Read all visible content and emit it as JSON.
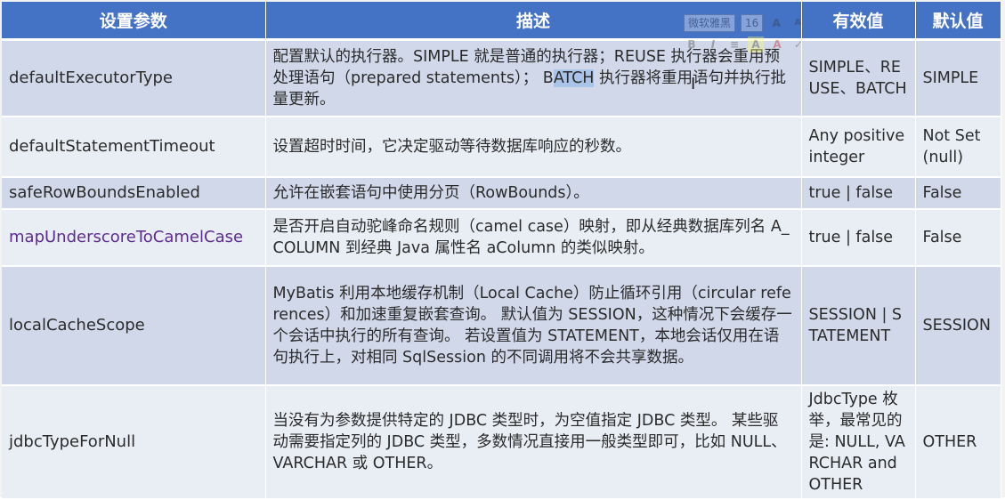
{
  "table": {
    "headers": [
      "设置参数",
      "描述",
      "有效值",
      "默认值"
    ],
    "rows": [
      {
        "param": "defaultExecutorType",
        "desc_before": "配置默认的执行器。SIMPLE 就是普通的执行器；REUSE 执行器会重用预处理语句（prepared statements）； B",
        "desc_selected": "ATCH",
        "desc_after": " 执行器将重用语句并执行批量更新。",
        "valid": "SIMPLE、REUSE、BATCH",
        "default": "SIMPLE"
      },
      {
        "param": "defaultStatementTimeout",
        "desc": "设置超时时间，它决定驱动等待数据库响应的秒数。",
        "valid": "Any positive integer",
        "default": "Not Set (null)"
      },
      {
        "param": "safeRowBoundsEnabled",
        "desc": "允许在嵌套语句中使用分页（RowBounds）。",
        "valid": "true | false",
        "default": "False"
      },
      {
        "param": "mapUnderscoreToCamelCase",
        "desc": "是否开启自动驼峰命名规则（camel case）映射，即从经典数据库列名 A_COLUMN 到经典 Java 属性名 aColumn 的类似映射。",
        "valid": "true | false",
        "default": "False"
      },
      {
        "param": "localCacheScope",
        "desc": "MyBatis 利用本地缓存机制（Local Cache）防止循环引用（circular references）和加速重复嵌套查询。 默认值为 SESSION，这种情况下会缓存一个会话中执行的所有查询。 若设置值为 STATEMENT，本地会话仅用在语句执行上，对相同 SqlSession 的不同调用将不会共享数据。",
        "valid": "SESSION | STATEMENT",
        "default": "SESSION"
      },
      {
        "param": "jdbcTypeForNull",
        "desc": "当没有为参数提供特定的 JDBC 类型时，为空值指定 JDBC 类型。 某些驱动需要指定列的 JDBC 类型，多数情况直接用一般类型即可，比如 NULL、VARCHAR 或 OTHER。",
        "valid": "JdbcType 枚举，最常见的是: NULL, VARCHAR and OTHER",
        "default": "OTHER"
      }
    ]
  },
  "mini_toolbar": {
    "font_name": "微软雅黑",
    "font_size": "16",
    "grow_font": "A",
    "shrink_font": "A",
    "bold": "B",
    "italic": "I",
    "align": "≡",
    "highlight": "A",
    "font_color": "A",
    "format_painter": "✓"
  },
  "cursor_glyph": "I",
  "colors": {
    "header_bg": "#4472c4",
    "row_odd": "#d0d8ea",
    "row_even": "#e9edf4",
    "visited_link": "#5c2d91",
    "selection": "#a9c4e8"
  }
}
